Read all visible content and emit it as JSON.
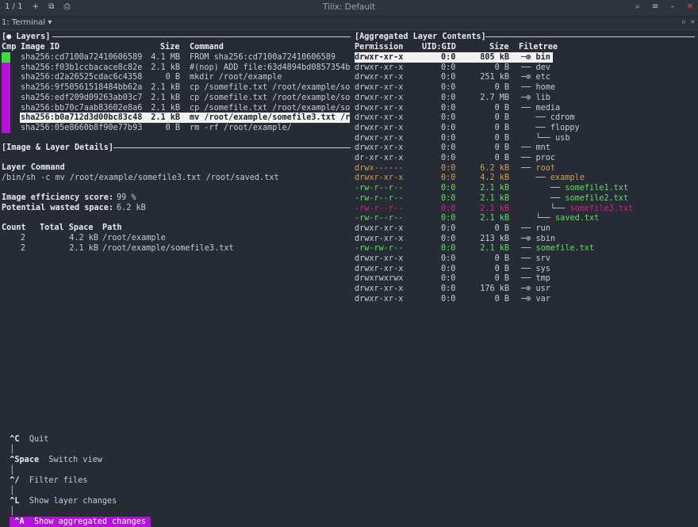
{
  "window": {
    "counter": "1 / 1",
    "title": "Tilix: Default",
    "tab_title": "1: Terminal"
  },
  "layers_panel": {
    "header": "[● Layers]",
    "columns": {
      "cmp": "Cmp",
      "image_id": "Image ID",
      "size": "Size",
      "command": "Command"
    },
    "rows": [
      {
        "id": "sha256:cd7100a72410606589",
        "size": "4.1 MB",
        "command": "FROM sha256:cd7100a72410606589"
      },
      {
        "id": "sha256:f03b1ccbacace8c82e",
        "size": "2.1 kB",
        "command": "#(nop) ADD file:63d4894bd0857354b"
      },
      {
        "id": "sha256:d2a26525cdac6c4358",
        "size": "0 B",
        "command": "mkdir /root/example"
      },
      {
        "id": "sha256:9f50561518484bb62a",
        "size": "2.1 kB",
        "command": "cp /somefile.txt /root/example/so"
      },
      {
        "id": "sha256:edf209d09263ab03c7",
        "size": "2.1 kB",
        "command": "cp /somefile.txt /root/example/so"
      },
      {
        "id": "sha256:bb70c7aab83602e8a6",
        "size": "2.1 kB",
        "command": "cp /somefile.txt /root/example/so"
      },
      {
        "id": "sha256:b0a712d3d00bc83c48",
        "size": "2.1 kB",
        "command": "mv /root/example/somefile3.txt /r"
      },
      {
        "id": "sha256:05e8660b8f90e77b93",
        "size": "0 B",
        "command": "rm -rf /root/example/"
      }
    ]
  },
  "details_panel": {
    "header": "[Image & Layer Details]",
    "layer_command_label": "Layer Command",
    "layer_command": "/bin/sh -c mv /root/example/somefile3.txt /root/saved.txt",
    "efficiency_label": "Image efficiency score:",
    "efficiency_value": "99 %",
    "wasted_label": "Potential wasted space:",
    "wasted_value": "6.2 kB",
    "table_headers": {
      "count": "Count",
      "total_space": "Total Space",
      "path": "Path"
    },
    "table_rows": [
      {
        "count": "2",
        "total": "4.2 kB",
        "path": "/root/example"
      },
      {
        "count": "2",
        "total": "2.1 kB",
        "path": "/root/example/somefile3.txt"
      }
    ]
  },
  "contents_panel": {
    "header": "[Aggregated Layer Contents]",
    "columns": {
      "permission": "Permission",
      "uid_gid": "UID:GID",
      "size": "Size",
      "filetree": "Filetree"
    },
    "rows": [
      {
        "perm": "drwxr-xr-x",
        "uid": "0:0",
        "size": "805 kB",
        "tree": "─⊕ ",
        "name": "bin"
      },
      {
        "perm": "drwxr-xr-x",
        "uid": "0:0",
        "size": "0 B",
        "tree": "── ",
        "name": "dev"
      },
      {
        "perm": "drwxr-xr-x",
        "uid": "0:0",
        "size": "251 kB",
        "tree": "─⊕ ",
        "name": "etc"
      },
      {
        "perm": "drwxr-xr-x",
        "uid": "0:0",
        "size": "0 B",
        "tree": "── ",
        "name": "home"
      },
      {
        "perm": "drwxr-xr-x",
        "uid": "0:0",
        "size": "2.7 MB",
        "tree": "─⊕ ",
        "name": "lib"
      },
      {
        "perm": "drwxr-xr-x",
        "uid": "0:0",
        "size": "0 B",
        "tree": "── ",
        "name": "media"
      },
      {
        "perm": "drwxr-xr-x",
        "uid": "0:0",
        "size": "0 B",
        "tree": "   ── ",
        "name": "cdrom"
      },
      {
        "perm": "drwxr-xr-x",
        "uid": "0:0",
        "size": "0 B",
        "tree": "   ── ",
        "name": "floppy"
      },
      {
        "perm": "drwxr-xr-x",
        "uid": "0:0",
        "size": "0 B",
        "tree": "   └── ",
        "name": "usb"
      },
      {
        "perm": "drwxr-xr-x",
        "uid": "0:0",
        "size": "0 B",
        "tree": "── ",
        "name": "mnt"
      },
      {
        "perm": "dr-xr-xr-x",
        "uid": "0:0",
        "size": "0 B",
        "tree": "── ",
        "name": "proc"
      },
      {
        "perm": "drwx------",
        "uid": "0:0",
        "size": "6.2 kB",
        "tree": "── ",
        "name": "root"
      },
      {
        "perm": "drwxr-xr-x",
        "uid": "0:0",
        "size": "4.2 kB",
        "tree": "   ── ",
        "name": "example"
      },
      {
        "perm": "-rw-r--r--",
        "uid": "0:0",
        "size": "2.1 kB",
        "tree": "      ── ",
        "name": "somefile1.txt"
      },
      {
        "perm": "-rw-r--r--",
        "uid": "0:0",
        "size": "2.1 kB",
        "tree": "      ── ",
        "name": "somefile2.txt"
      },
      {
        "perm": "-rw-r--r--",
        "uid": "0:0",
        "size": "2.1 kB",
        "tree": "      └── ",
        "name": "somefile3.txt"
      },
      {
        "perm": "-rw-r--r--",
        "uid": "0:0",
        "size": "2.1 kB",
        "tree": "   └── ",
        "name": "saved.txt"
      },
      {
        "perm": "drwxr-xr-x",
        "uid": "0:0",
        "size": "0 B",
        "tree": "── ",
        "name": "run"
      },
      {
        "perm": "drwxr-xr-x",
        "uid": "0:0",
        "size": "213 kB",
        "tree": "─⊕ ",
        "name": "sbin"
      },
      {
        "perm": "-rw-rw-r--",
        "uid": "0:0",
        "size": "2.1 kB",
        "tree": "── ",
        "name": "somefile.txt"
      },
      {
        "perm": "drwxr-xr-x",
        "uid": "0:0",
        "size": "0 B",
        "tree": "── ",
        "name": "srv"
      },
      {
        "perm": "drwxr-xr-x",
        "uid": "0:0",
        "size": "0 B",
        "tree": "── ",
        "name": "sys"
      },
      {
        "perm": "drwxrwxrwx",
        "uid": "0:0",
        "size": "0 B",
        "tree": "── ",
        "name": "tmp"
      },
      {
        "perm": "drwxr-xr-x",
        "uid": "0:0",
        "size": "176 kB",
        "tree": "─⊕ ",
        "name": "usr"
      },
      {
        "perm": "drwxr-xr-x",
        "uid": "0:0",
        "size": "0 B",
        "tree": "─⊕ ",
        "name": "var"
      }
    ]
  },
  "status_bar": {
    "quit_key": "^C",
    "quit_label": "Quit",
    "switch_key": "^Space",
    "switch_label": "Switch view",
    "filter_key": "^/",
    "filter_label": "Filter files",
    "layer_changes_key": "^L",
    "layer_changes_label": "Show layer changes",
    "aggregated_key": "^A",
    "aggregated_label": "Show aggregated changes"
  },
  "colors": {
    "background": "#272b35",
    "accent_purple": "#b611d9",
    "added_green": "#5fe05f",
    "modified_orange": "#d0a050",
    "removed_red": "#d8207a"
  }
}
